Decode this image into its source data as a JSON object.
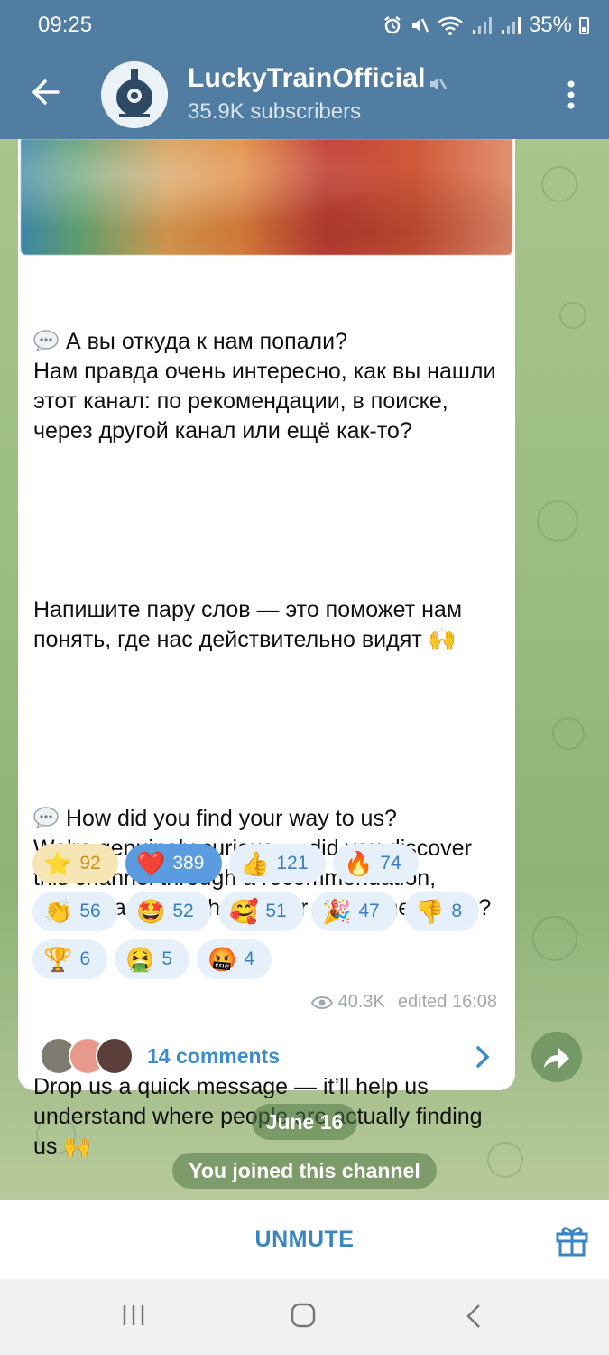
{
  "status_bar": {
    "time": "09:25",
    "battery": "35%"
  },
  "header": {
    "title": "LuckyTrainOfficial",
    "subscribers": "35.9K subscribers"
  },
  "post": {
    "ru_para1": "А вы откуда к нам попали?\nНам правда очень интересно, как вы нашли этот канал: по рекомендации, в поиске, через другой канал или ещё как-то?",
    "ru_para2": "Напишите пару слов — это поможет нам понять, где нас действительно видят 🙌",
    "en_para1": "How did you find your way to us?\nWe’re genuinely curious — did you discover this channel through a recommendation, search, another channel, or somewhere else?",
    "en_para2": "Drop us a quick message — it’ll help us understand where people are actually finding us 🙌"
  },
  "reactions": [
    {
      "emoji": "⭐",
      "count": "92"
    },
    {
      "emoji": "❤️",
      "count": "389"
    },
    {
      "emoji": "👍",
      "count": "121"
    },
    {
      "emoji": "🔥",
      "count": "74"
    },
    {
      "emoji": "👏",
      "count": "56"
    },
    {
      "emoji": "🤩",
      "count": "52"
    },
    {
      "emoji": "🥰",
      "count": "51"
    },
    {
      "emoji": "🎉",
      "count": "47"
    },
    {
      "emoji": "👎",
      "count": "8"
    },
    {
      "emoji": "🏆",
      "count": "6"
    },
    {
      "emoji": "🤮",
      "count": "5"
    },
    {
      "emoji": "🤬",
      "count": "4"
    }
  ],
  "meta": {
    "views": "40.3K",
    "edited": "edited 16:08"
  },
  "comments": {
    "label": "14 comments"
  },
  "date_divider": "June 16",
  "service_message": "You joined this channel",
  "bottom": {
    "unmute_label": "UNMUTE"
  },
  "colors": {
    "header": "#517da2",
    "accent": "#3a85c4",
    "heart_reaction": "#5b9be0",
    "star_reaction": "#f7e6b5"
  }
}
